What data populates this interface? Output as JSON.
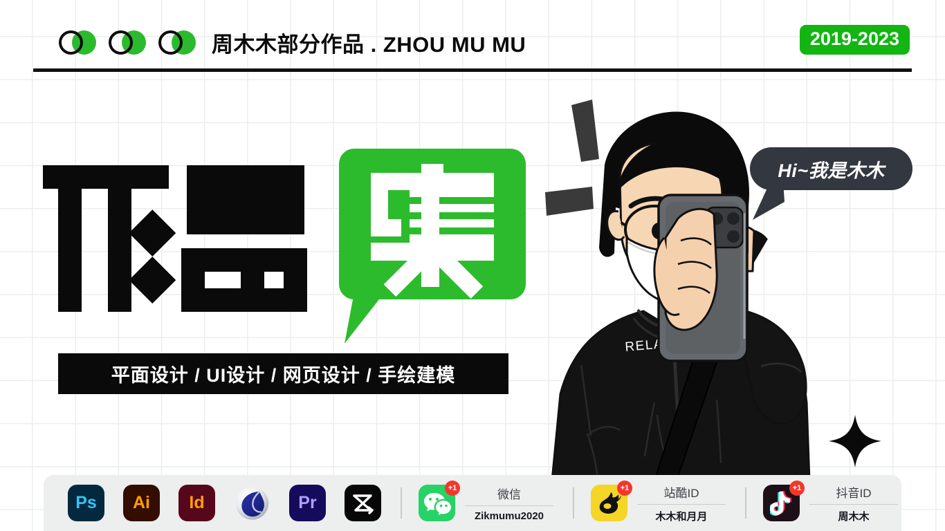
{
  "header": {
    "dots": [
      {
        "name": "dot-pair-1"
      },
      {
        "name": "dot-pair-2"
      },
      {
        "name": "dot-pair-3"
      }
    ],
    "title": "周木木部分作品 . ZHOU MU MU",
    "year_badge": "2019-2023"
  },
  "hero": {
    "title_characters": [
      "作",
      "品",
      "集"
    ],
    "title_text": "作品集",
    "bubble_character": "集",
    "subtitle": "平面设计 / UI设计 /  网页设计 / 手绘建模",
    "speech_bubble": "Hi~我是木木",
    "hoodie_text": "RELAD",
    "sparkle_icon": "four-point-star-icon"
  },
  "toolbar": {
    "apps": [
      {
        "id": "ps",
        "label": "Ps",
        "icon": "photoshop-icon",
        "bg": "#04293f",
        "fg": "#31c5f5"
      },
      {
        "id": "ai",
        "label": "Ai",
        "icon": "illustrator-icon",
        "bg": "#320d00",
        "fg": "#ffa000"
      },
      {
        "id": "id",
        "label": "Id",
        "icon": "indesign-icon",
        "bg": "#56071c",
        "fg": "#ffa000"
      },
      {
        "id": "c4d",
        "label": "",
        "icon": "cinema4d-icon",
        "bg": "#ffffff",
        "fg": "#1c2a8c"
      },
      {
        "id": "pr",
        "label": "Pr",
        "icon": "premiere-icon",
        "bg": "#140b5c",
        "fg": "#aea0ff"
      },
      {
        "id": "cc",
        "label": "",
        "icon": "capcut-icon",
        "bg": "#070707",
        "fg": "#ffffff"
      }
    ],
    "socials": [
      {
        "id": "wechat",
        "icon": "wechat-icon",
        "badge": "+1",
        "label": "微信",
        "value": "Zikmumu2020"
      },
      {
        "id": "zcool",
        "icon": "zcool-icon",
        "badge": "+1",
        "label": "站酷ID",
        "value": "木木和月月"
      },
      {
        "id": "douyin",
        "icon": "douyin-icon",
        "badge": "+1",
        "label": "抖音ID",
        "value": "周木木"
      }
    ]
  },
  "colors": {
    "accent_green": "#2bba2e",
    "badge_green": "#12b512",
    "ink": "#0a0a0a",
    "bubble_dark": "#333740",
    "grid_line": "#eceded",
    "toolbar_bg": "#edeeee",
    "badge_red": "#f4372b"
  }
}
